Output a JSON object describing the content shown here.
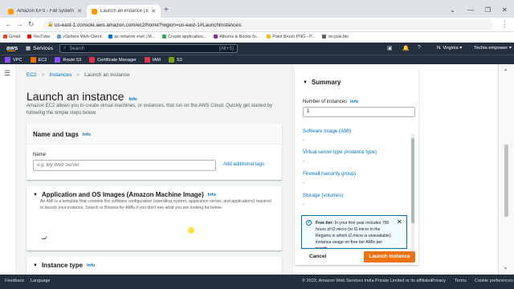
{
  "browser": {
    "tabs": [
      {
        "title": "Amazon EFS - File system config",
        "icon_color": "#ff9900",
        "active": false
      },
      {
        "title": "Launch an instance | EC2 Manag",
        "icon_color": "#ff9900",
        "active": true
      }
    ],
    "new_tab": "+",
    "url": "us-east-1.console.aws.amazon.com/ec2/home?region=us-east-1#LaunchInstances:",
    "bookmarks": [
      {
        "label": "Gmail",
        "color": "#ea4335"
      },
      {
        "label": "YouTube",
        "color": "#ff0000"
      },
      {
        "label": "vSphere Web Client",
        "color": "#6d9bc3"
      },
      {
        "label": "az network vnet | M...",
        "color": "#0078d4"
      },
      {
        "label": "Create application...",
        "color": "#34a853"
      },
      {
        "label": "Albums & Books fo...",
        "color": "#8e24aa"
      },
      {
        "label": "Paint Brush PNG - P...",
        "color": "#fbbc04"
      },
      {
        "label": "recycle.bin",
        "color": "#5f6368"
      }
    ]
  },
  "aws_nav": {
    "logo": "aws",
    "services": "Services",
    "search_placeholder": "Search",
    "search_shortcut": "[Alt+S]",
    "region": "N. Virginia",
    "account": "Techie.empower"
  },
  "favorites": [
    {
      "label": "VPC",
      "color": "#8c4fff"
    },
    {
      "label": "EC2",
      "color": "#ed7100"
    },
    {
      "label": "Route 53",
      "color": "#8c4fff"
    },
    {
      "label": "Certificate Manager",
      "color": "#dd344c"
    },
    {
      "label": "IAM",
      "color": "#dd344c"
    },
    {
      "label": "S3",
      "color": "#7aa116"
    }
  ],
  "breadcrumbs": {
    "ec2": "EC2",
    "instances": "Instances",
    "current": "Launch an instance",
    "sep": ">"
  },
  "page": {
    "title": "Launch an instance",
    "info": "Info",
    "description": "Amazon EC2 allows you to create virtual machines, or instances, that run on the AWS Cloud. Quickly get started by following the simple steps below."
  },
  "name_tags": {
    "title": "Name and tags",
    "info": "Info",
    "name_label": "Name",
    "name_placeholder": "e.g. My Web Server",
    "add_tags": "Add additional tags"
  },
  "ami": {
    "title": "Application and OS Images (Amazon Machine Image)",
    "info": "Info",
    "description": "An AMI is a template that contains the software configuration (operating system, application server, and applications) required to launch your instance. Search or Browse for AMIs if you don't see what you are looking for below"
  },
  "instance_type": {
    "title": "Instance type",
    "info": "Info"
  },
  "summary": {
    "title": "Summary",
    "num_instances_label": "Number of instances",
    "num_instances_info": "Info",
    "num_instances_value": "1",
    "items": [
      {
        "label": "Software Image (AMI)",
        "value": "-"
      },
      {
        "label": "Virtual server type (instance type)",
        "value": "-"
      },
      {
        "label": "Firewall (security group)",
        "value": "-"
      },
      {
        "label": "Storage (volumes)",
        "value": "-"
      }
    ],
    "free_tier": {
      "heading": "Free tier:",
      "text": "In your first year includes 750 hours of t2.micro (or t3.micro in the Regions in which t2.micro is unavailable) instance usage on free tier AMIs per month"
    },
    "cancel": "Cancel",
    "launch": "Launch instance"
  },
  "footer": {
    "feedback": "Feedback",
    "language": "Language",
    "copyright": "© 2023, Amazon Web Services India Private Limited or its affiliates.",
    "privacy": "Privacy",
    "terms": "Terms",
    "cookie": "Cookie preferences"
  }
}
